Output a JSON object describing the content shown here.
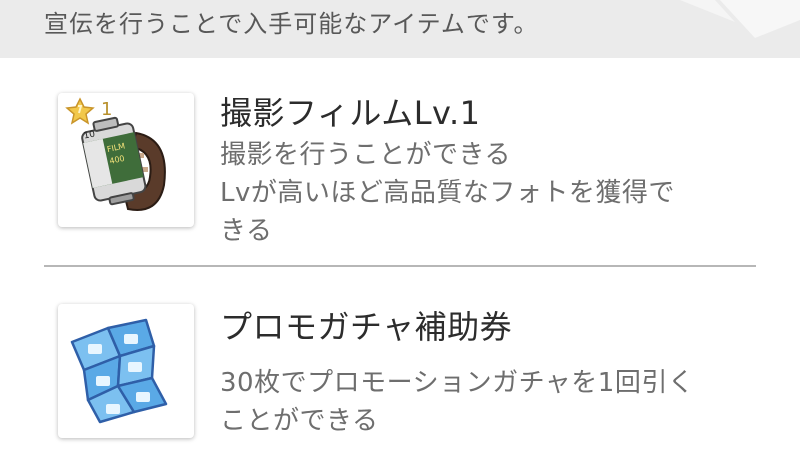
{
  "header": {
    "text": "宣伝を行うことで入手可能なアイテムです。"
  },
  "items": [
    {
      "icon": "film-roll-icon",
      "rarity": "1",
      "title": "撮影フィルムLv.1",
      "desc_lines": [
        "撮影を行うことができる",
        "Lvが高いほど高品質なフォトを獲得で",
        "きる"
      ]
    },
    {
      "icon": "gacha-ticket-icon",
      "title": "プロモガチャ補助券",
      "desc_lines": [
        "30枚でプロモーションガチャを1回引く",
        "ことができる"
      ]
    }
  ],
  "colors": {
    "header_bg": "#ebebeb",
    "divider": "#b7b7b7",
    "rarity_star": "#f2c84b",
    "ticket_blue": "#5aa9e6"
  }
}
